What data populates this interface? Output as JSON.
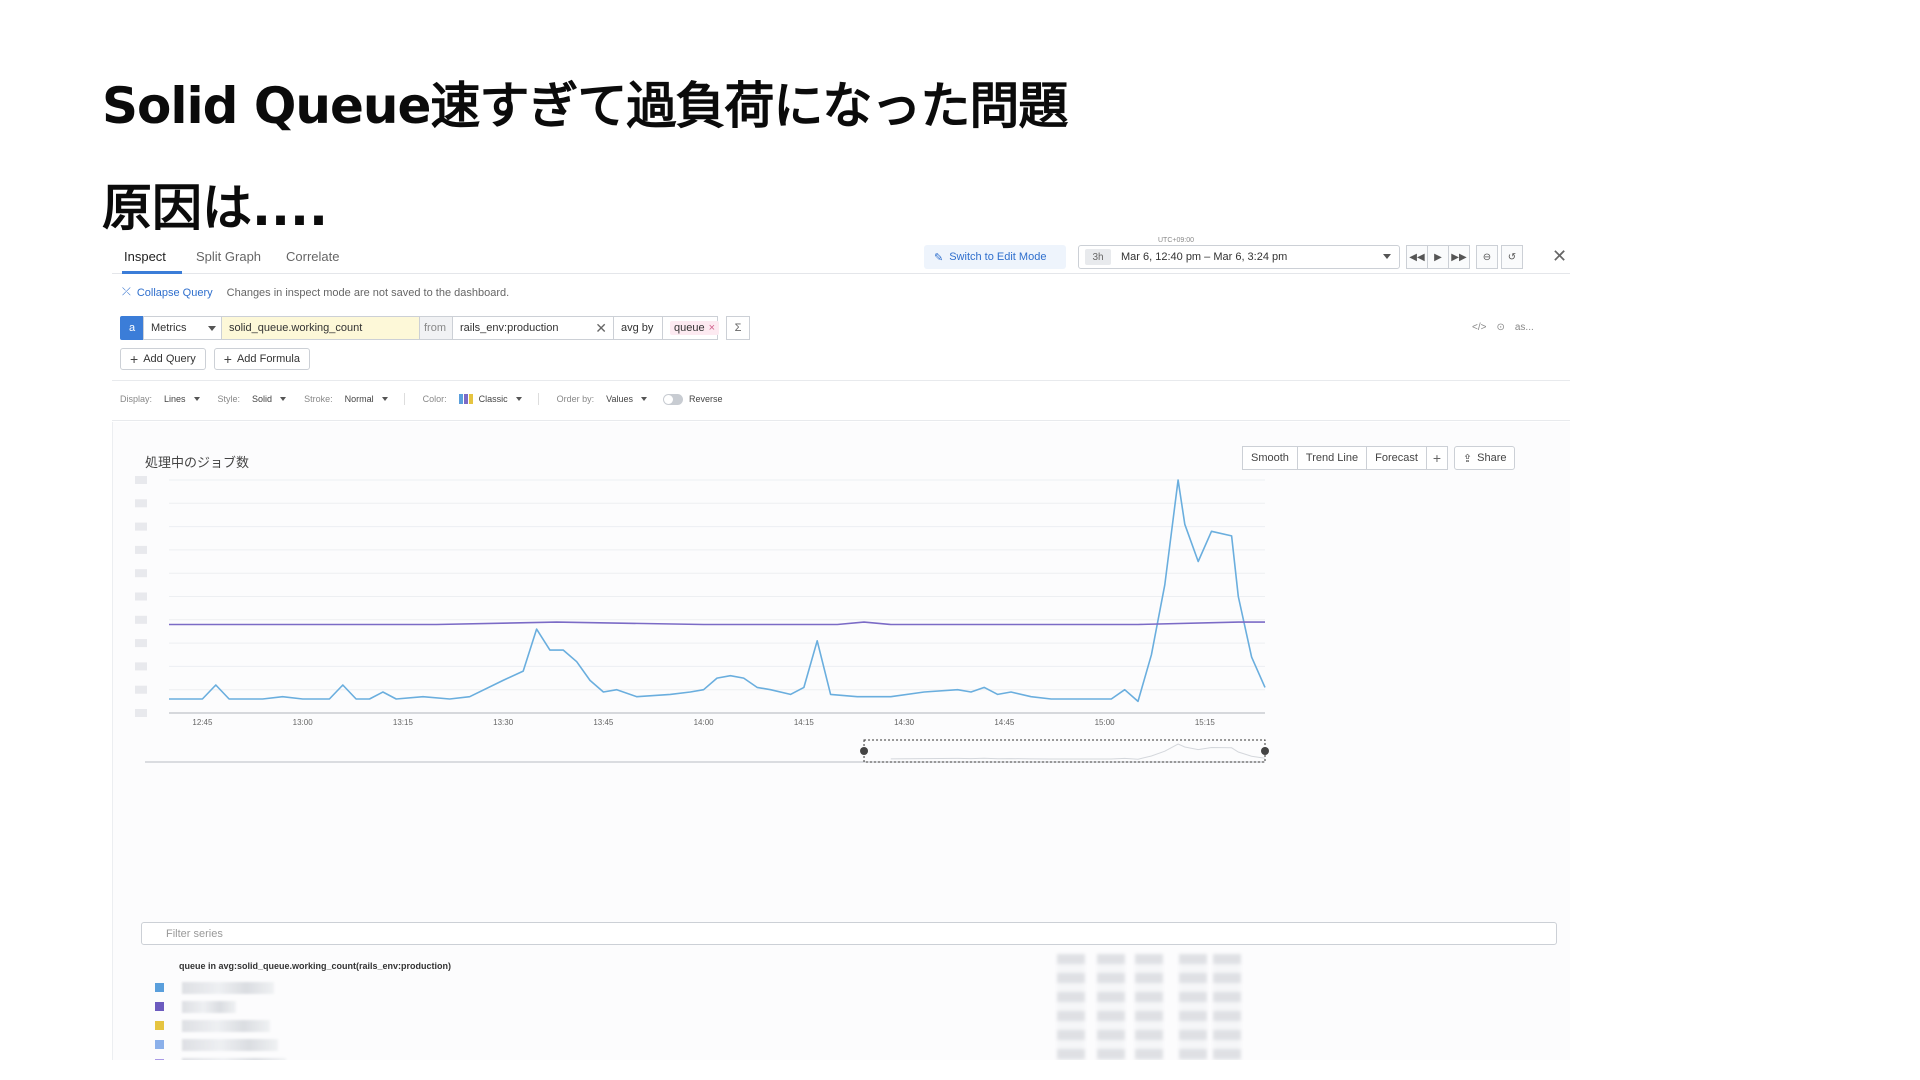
{
  "slide": {
    "title": "Solid Queue速すぎて過負荷になった問題",
    "subtitle": "原因は...."
  },
  "tabs": [
    {
      "label": "Inspect",
      "active": true
    },
    {
      "label": "Split Graph",
      "active": false
    },
    {
      "label": "Correlate",
      "active": false
    }
  ],
  "toolbar": {
    "edit_mode_label": "Switch to Edit Mode",
    "timezone": "UTC+09:00",
    "time_badge": "3h",
    "time_range": "Mar 6, 12:40 pm – Mar 6, 3:24 pm"
  },
  "query_panel": {
    "collapse_label": "Collapse Query",
    "unsaved_note": "Changes in inspect mode are not saved to the dashboard.",
    "query_letter": "a",
    "source": "Metrics",
    "metric": "solid_queue.working_count",
    "from_label": "from",
    "filter": "rails_env:production",
    "avg_by_label": "avg by",
    "group_tag": "queue",
    "sigma": "Σ",
    "right_icons": [
      "</>",
      "⊙",
      "as..."
    ],
    "add_query_label": "Add Query",
    "add_formula_label": "Add Formula"
  },
  "display_options": {
    "display_label": "Display:",
    "display_value": "Lines",
    "style_label": "Style:",
    "style_value": "Solid",
    "stroke_label": "Stroke:",
    "stroke_value": "Normal",
    "color_label": "Color:",
    "color_value": "Classic",
    "order_label": "Order by:",
    "order_value": "Values",
    "reverse_label": "Reverse"
  },
  "graph": {
    "title": "処理中のジョブ数",
    "actions": [
      "Smooth",
      "Trend Line",
      "Forecast"
    ],
    "share_label": "Share",
    "filter_placeholder": "Filter series",
    "legend_header": "queue in avg:solid_queue.working_count(rails_env:production)"
  },
  "chart_data": {
    "type": "line",
    "title": "処理中のジョブ数",
    "xlabel": "",
    "ylabel": "",
    "x_ticks": [
      "12:45",
      "13:00",
      "13:15",
      "13:30",
      "13:45",
      "14:00",
      "14:15",
      "14:30",
      "14:45",
      "15:00",
      "15:15"
    ],
    "x_range_minutes": [
      0,
      164
    ],
    "y_range": [
      0,
      100
    ],
    "y_ticks_note": "",
    "grid": true,
    "series": [
      {
        "color": "#6aaede",
        "points": [
          [
            0,
            6
          ],
          [
            5,
            6
          ],
          [
            7,
            12
          ],
          [
            9,
            6
          ],
          [
            14,
            6
          ],
          [
            17,
            7
          ],
          [
            20,
            6
          ],
          [
            24,
            6
          ],
          [
            26,
            12
          ],
          [
            28,
            6
          ],
          [
            30,
            6
          ],
          [
            32,
            9
          ],
          [
            34,
            6
          ],
          [
            38,
            7
          ],
          [
            42,
            6
          ],
          [
            45,
            7
          ],
          [
            50,
            14
          ],
          [
            53,
            18
          ],
          [
            55,
            36
          ],
          [
            57,
            27
          ],
          [
            59,
            27
          ],
          [
            61,
            22
          ],
          [
            63,
            14
          ],
          [
            65,
            9
          ],
          [
            67,
            10
          ],
          [
            70,
            7
          ],
          [
            75,
            8
          ],
          [
            78,
            9
          ],
          [
            80,
            10
          ],
          [
            82,
            15
          ],
          [
            84,
            16
          ],
          [
            86,
            15
          ],
          [
            88,
            11
          ],
          [
            90,
            10
          ],
          [
            93,
            8
          ],
          [
            95,
            11
          ],
          [
            97,
            31
          ],
          [
            99,
            8
          ],
          [
            103,
            7
          ],
          [
            108,
            7
          ],
          [
            113,
            9
          ],
          [
            118,
            10
          ],
          [
            120,
            9
          ],
          [
            122,
            11
          ],
          [
            124,
            8
          ],
          [
            126,
            9
          ],
          [
            129,
            7
          ],
          [
            132,
            6
          ],
          [
            137,
            6
          ],
          [
            141,
            6
          ],
          [
            143,
            10
          ],
          [
            145,
            5
          ],
          [
            147,
            25
          ],
          [
            149,
            55
          ],
          [
            151,
            100
          ],
          [
            152,
            81
          ],
          [
            154,
            65
          ],
          [
            156,
            78
          ],
          [
            159,
            76
          ],
          [
            160,
            50
          ],
          [
            162,
            24
          ],
          [
            164,
            11
          ]
        ]
      },
      {
        "color": "#7b6bc6",
        "points": [
          [
            0,
            38
          ],
          [
            20,
            38
          ],
          [
            40,
            38
          ],
          [
            58,
            39
          ],
          [
            80,
            38
          ],
          [
            100,
            38
          ],
          [
            104,
            39
          ],
          [
            108,
            38
          ],
          [
            130,
            38
          ],
          [
            145,
            38
          ],
          [
            160,
            39
          ],
          [
            164,
            39
          ]
        ]
      }
    ],
    "legend": {
      "colors": [
        "#5a9fdc",
        "#6c5bbf",
        "#e6c440",
        "#8bb0ea",
        "#a99ae6",
        "#f0dc8c"
      ]
    },
    "navigator_selection_minutes": [
      104,
      164
    ]
  },
  "colors": {
    "accent": "#3b7dd8",
    "metric_highlight": "#fdf8d8",
    "tag_pink": "#fdeaf1"
  }
}
